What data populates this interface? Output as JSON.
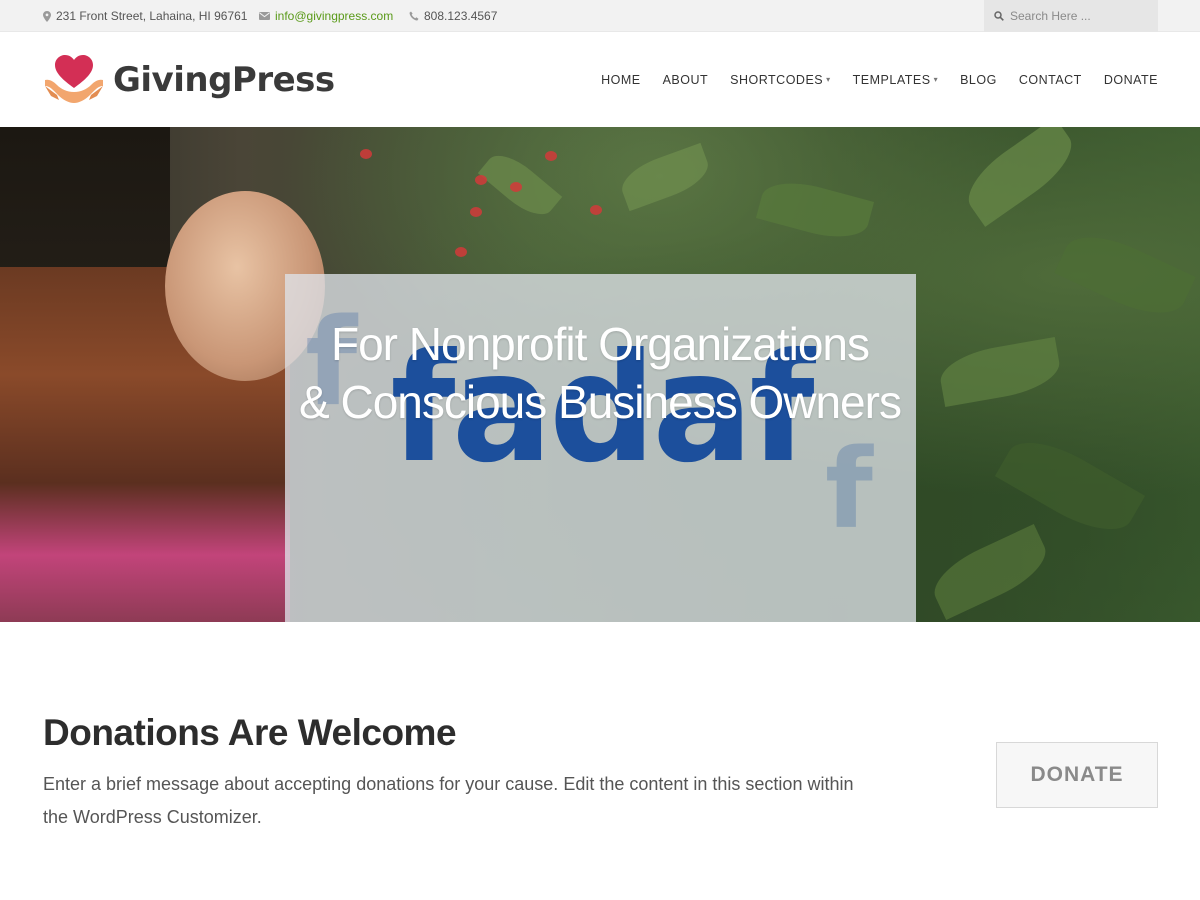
{
  "topbar": {
    "address": "231 Front Street, Lahaina, HI 96761",
    "email": "info@givingpress.com",
    "phone": "808.123.4567",
    "search_placeholder": "Search Here ..."
  },
  "logo": {
    "text": "GivingPress",
    "icon": "heart-hands-icon"
  },
  "nav": {
    "items": [
      {
        "label": "HOME"
      },
      {
        "label": "ABOUT"
      },
      {
        "label": "SHORTCODES",
        "has_dropdown": true
      },
      {
        "label": "TEMPLATES",
        "has_dropdown": true
      },
      {
        "label": "BLOG"
      },
      {
        "label": "CONTACT"
      },
      {
        "label": "DONATE"
      }
    ]
  },
  "hero": {
    "line1": "For Nonprofit Organizations",
    "line2": "& Conscious Business Owners",
    "overlay_text": "fadaf"
  },
  "donations": {
    "title": "Donations Are Welcome",
    "text": "Enter a brief message about accepting donations for your cause. Edit the content in this section within the WordPress Customizer.",
    "button": "DONATE"
  },
  "colors": {
    "accent_green": "#5a9a19",
    "logo_heart": "#d32f55",
    "logo_hands": "#f2a66e",
    "overlay_blue": "#1c4f9c"
  }
}
